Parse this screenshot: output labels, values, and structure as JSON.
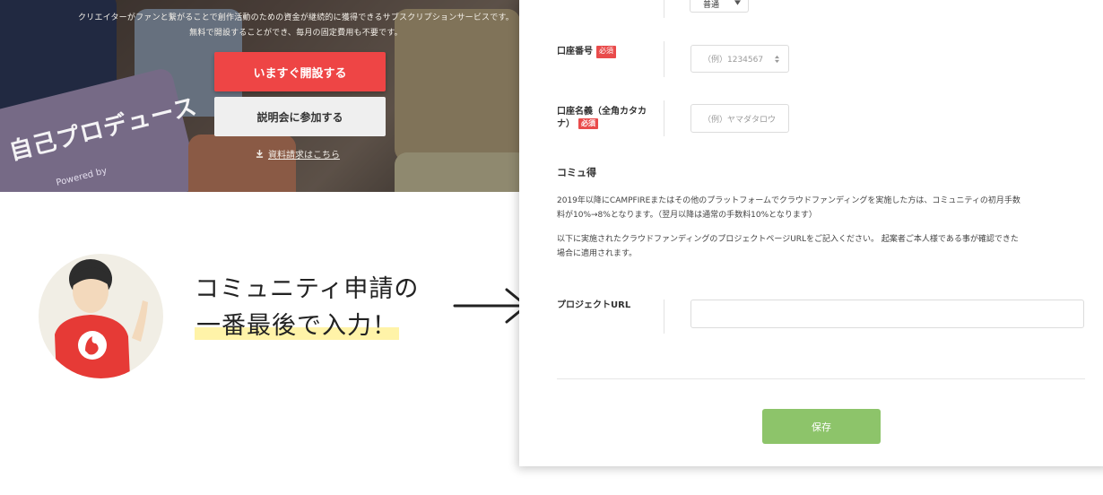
{
  "hero": {
    "lead_line1": "クリエイターがファンと繋がることで創作活動のための資金が継続的に獲得できるサブスクリプションサービスです。",
    "lead_line2": "無料で開設することができ、毎月の固定費用も不要です。",
    "primary_button": "いますぐ開設する",
    "secondary_button": "説明会に参加する",
    "document_link": "資料請求はこちら",
    "overlay_text": "自己プロデュース",
    "overlay_small_text": "Powered by"
  },
  "callout": {
    "line1": "コミュニティ申請の",
    "line2": "一番最後で入力！"
  },
  "form": {
    "top_select_value": "普通",
    "account_number": {
      "label": "口座番号",
      "required": "必須",
      "placeholder": "（例）1234567"
    },
    "account_name": {
      "label_line1": "口座名義（全角カタカ",
      "label_line2": "ナ）",
      "required": "必須",
      "placeholder": "（例）ヤマダタロウ"
    },
    "section_title": "コミュ得",
    "paragraph1_line1": "2019年以降にCAMPFIREまたはその他のプラットフォームでクラウドファンディングを実施した方は、コミュニティの初月手数",
    "paragraph1_line2": "料が10%→8%となります。（翌月以降は通常の手数料10%となります）",
    "paragraph2_line1": "以下に実施されたクラウドファンディングのプロジェクトページURLをご記入ください。 起案者ご本人様である事が確認できた",
    "paragraph2_line2": "場合に適用されます。",
    "project_url": {
      "label": "プロジェクトURL",
      "value": ""
    },
    "save_button": "保存"
  },
  "colors": {
    "primary_red": "#ee4545",
    "required_red": "#e94b4b",
    "save_green": "#8dc46a",
    "highlight_yellow": "#fff3a8"
  }
}
